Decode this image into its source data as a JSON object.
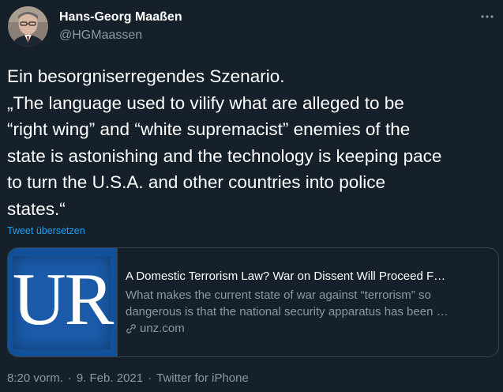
{
  "author": {
    "name": "Hans-Georg Maaßen",
    "handle": "@HGMaassen"
  },
  "more_icon": "more-horizontal-icon",
  "tweet": {
    "lines": [
      "Ein besorgniserregendes Szenario.",
      "„The language used to vilify what are alleged to be",
      "“right wing” and “white supremacist” enemies of the",
      "state is astonishing and the technology is keeping pace",
      "to turn the U.S.A. and other countries into police",
      "states.“"
    ],
    "translate_label": "Tweet übersetzen"
  },
  "card": {
    "logo_text": "UR",
    "title": "A Domestic Terrorism Law? War on Dissent Will Proceed F…",
    "description_lines": [
      "What makes the current state of war against “terrorism” so",
      "dangerous is that the national security apparatus has been …"
    ],
    "domain": "unz.com",
    "colors": {
      "image_background": "#1a5aa8"
    }
  },
  "meta": {
    "time": "8:20 vorm.",
    "separator": "·",
    "date": "9. Feb. 2021",
    "source": "Twitter for iPhone"
  },
  "colors": {
    "background": "#15202b",
    "primary_text": "#ffffff",
    "secondary_text": "#8899a6",
    "accent": "#1da1f2",
    "border": "#38444d"
  }
}
